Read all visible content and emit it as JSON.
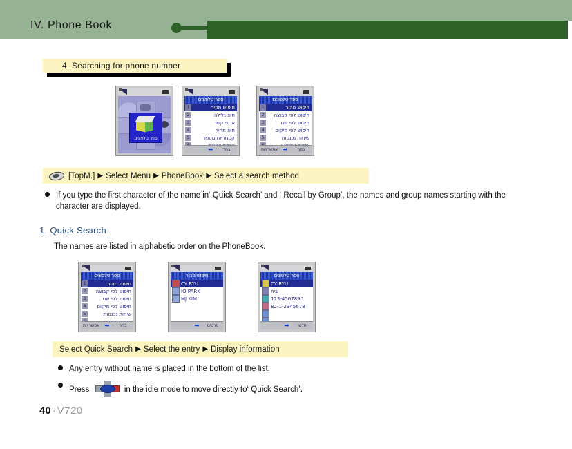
{
  "header": {
    "chapter_title": "IV. Phone Book",
    "light_green": "#95b292",
    "dark_green": "#2d6128"
  },
  "section": {
    "title": "4. Searching for phone number",
    "box_color": "#fcf4c0"
  },
  "phones_row1": [
    {
      "name": "main-menu-screen",
      "type": "menugrid",
      "selected_label": "ספר טלפונים",
      "softkeys": {
        "left": "",
        "right": ""
      }
    },
    {
      "name": "phonebook-menu-screen",
      "type": "list",
      "title": "ספר טלפונים",
      "rows": [
        {
          "num": "1",
          "label": "חיפוש מהיר",
          "selected": true
        },
        {
          "num": "2",
          "label": "חיוג גלילה",
          "selected": false
        },
        {
          "num": "3",
          "label": "אנשי קשר",
          "selected": false
        },
        {
          "num": "4",
          "label": "חיוג מהיר",
          "selected": false
        },
        {
          "num": "5",
          "label": "קטגוריות מספר",
          "selected": false
        },
        {
          "num": "6",
          "label": "נעילת אנשים",
          "selected": false
        }
      ],
      "softkeys": {
        "left": "",
        "right": "בחר"
      }
    },
    {
      "name": "search-method-screen",
      "type": "list",
      "title": "ספר טלפונים",
      "rows": [
        {
          "num": "1",
          "label": "חיפוש מהיר",
          "selected": true
        },
        {
          "num": "2",
          "label": "חיפוש לפי קבוצה",
          "selected": false
        },
        {
          "num": "3",
          "label": "חיפוש לפי שם",
          "selected": false
        },
        {
          "num": "4",
          "label": "חיפוש לפי מיקום",
          "selected": false
        },
        {
          "num": "5",
          "label": "שיחות נכנסות",
          "selected": false
        },
        {
          "num": "6",
          "label": "שיחות שבוצעו",
          "selected": false
        }
      ],
      "softkeys": {
        "left": "אפשרויות",
        "right": "בחר"
      }
    }
  ],
  "step1": {
    "icon": "topm-key-icon",
    "parts": [
      "[TopM.]",
      "Select Menu",
      "PhoneBook",
      "Select a search method"
    ],
    "arrow": "▶"
  },
  "note1": "If you type the first character of the name in‘ Quick Search’ and ‘ Recall by Group’, the names and group names starting with the character are displayed.",
  "subsection": {
    "heading": "1. Quick Search",
    "text": "The names are listed in alphabetic order on the PhoneBook."
  },
  "phones_row2": [
    {
      "name": "quick-search-menu-screen",
      "type": "list",
      "title": "ספר טלפונים",
      "rows": [
        {
          "num": "1",
          "label": "חיפוש מהיר",
          "selected": true
        },
        {
          "num": "2",
          "label": "חיפוש לפי קבוצה",
          "selected": false
        },
        {
          "num": "3",
          "label": "חיפוש לפי שם",
          "selected": false
        },
        {
          "num": "4",
          "label": "חיפוש לפי מיקום",
          "selected": false
        },
        {
          "num": "5",
          "label": "שיחות נכנסות",
          "selected": false
        },
        {
          "num": "6",
          "label": "שיחות שבוצעו",
          "selected": false
        }
      ],
      "softkeys": {
        "left": "אפשרויות",
        "right": "בחר"
      }
    },
    {
      "name": "name-list-screen",
      "type": "namelist",
      "title": "חיפוש מהיר",
      "entries": [
        {
          "label": "CY RYU",
          "selected": true
        },
        {
          "label": "IO PARK",
          "selected": false
        },
        {
          "label": "MJ KIM",
          "selected": false
        }
      ],
      "softkeys": {
        "left": "",
        "right": "פרטים"
      }
    },
    {
      "name": "contact-detail-screen",
      "type": "detail",
      "title": "ספר טלפונים",
      "entries": [
        {
          "label": "CY RYU",
          "selected": true
        },
        {
          "label": "בית",
          "selected": false
        },
        {
          "label": "123-4567890",
          "selected": false
        },
        {
          "label": "82-1-2345678",
          "selected": false
        },
        {
          "label": "",
          "selected": false
        },
        {
          "label": "",
          "selected": false
        }
      ],
      "softkeys": {
        "left": "",
        "right": "חדש"
      }
    }
  ],
  "step2": {
    "parts": [
      "Select Quick Search",
      "Select the entry",
      "Display information"
    ],
    "arrow": "▶"
  },
  "note2": "Any entry without name is placed in the bottom of the list.",
  "note3_before": "Press",
  "note3_icon": "dpad-navigation-icon",
  "note3_after": "in the idle mode to move directly to‘ Quick Search’.",
  "footer": {
    "page": "40",
    "separator": "·",
    "model": "V720"
  }
}
